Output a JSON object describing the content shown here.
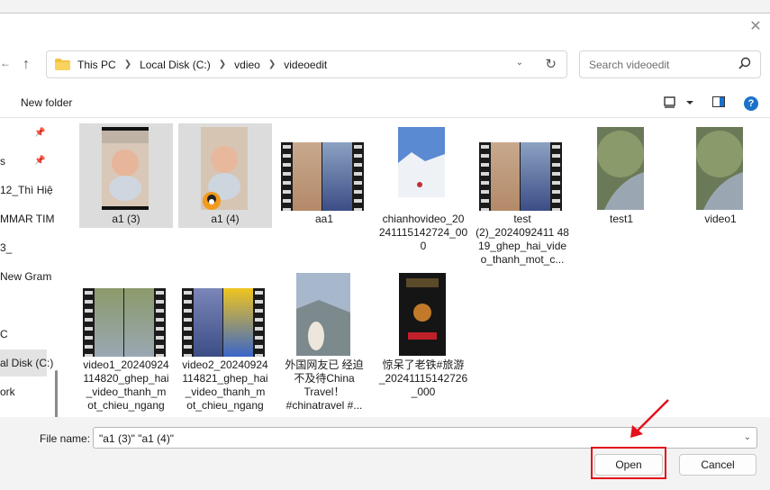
{
  "window": {
    "close_glyph": "✕"
  },
  "address": {
    "crumbs": [
      "This PC",
      "Local Disk (C:)",
      "vdieo",
      "videoedit"
    ],
    "search_placeholder": "Search videoedit"
  },
  "toolbar": {
    "new_folder": "New folder",
    "help_glyph": "?"
  },
  "sidebar": {
    "items": [
      {
        "label": "",
        "pinned": true
      },
      {
        "label": "s",
        "pinned": true
      },
      {
        "label": "12_Thì Hiệ"
      },
      {
        "label": "MMAR TIM"
      },
      {
        "label": "3_"
      },
      {
        "label": "New Gram"
      },
      {
        "label": "C"
      },
      {
        "label": "al Disk (C:)"
      },
      {
        "label": "ork"
      }
    ]
  },
  "files": [
    {
      "name": "a1 (3)",
      "kind": "portrait-photo",
      "selected": true
    },
    {
      "name": "a1 (4)",
      "kind": "portrait-photo",
      "selected": true
    },
    {
      "name": "aa1",
      "kind": "video"
    },
    {
      "name": "chianhovideo_20241115142724_000",
      "kind": "portrait-photo"
    },
    {
      "name": "test (2)_2024092411481 9_ghep_hai_video_thanh_mot_c...",
      "kind": "video"
    },
    {
      "name": "test1",
      "kind": "portrait-photo"
    },
    {
      "name": "video1",
      "kind": "portrait-photo"
    },
    {
      "name": "video1_20240924114820_ghep_hai_video_thanh_mot_chieu_ngang",
      "kind": "video"
    },
    {
      "name": "video2_20240924114821_ghep_hai_video_thanh_mot_chieu_ngang",
      "kind": "video"
    },
    {
      "name": "外国网友已经迫不及待China Travel！#chinatravel #...",
      "kind": "portrait-photo"
    },
    {
      "name": "惊呆了老铁#旅游_20241115142726_000",
      "kind": "portrait-photo"
    }
  ],
  "labels_display": [
    "a1 (3)",
    "a1 (4)",
    "aa1",
    "chianhovideo_20\n241115142724_00\n0",
    "test\n(2)_2024092411 48\n19_ghep_hai_vide\no_thanh_mot_c...",
    "test1",
    "video1",
    "video1_20240924\n114820_ghep_hai\n_video_thanh_m\not_chieu_ngang",
    "video2_20240924\n114821_ghep_hai\n_video_thanh_m\not_chieu_ngang",
    "外国网友已 经迫\n不及待China\nTravel！\n#chinatravel #...",
    "惊呆了老铁#旅游\n_20241115142726\n_000"
  ],
  "footer": {
    "file_name_label": "File name:",
    "file_name_value": "\"a1 (3)\" \"a1 (4)\"",
    "open_label": "Open",
    "cancel_label": "Cancel"
  },
  "colors": {
    "highlight": "#e5101a",
    "accent": "#1a73c9",
    "selection": "#dcdcdc"
  },
  "icons": [
    "folder-icon",
    "up-arrow-icon",
    "chevron-down-icon",
    "refresh-icon",
    "search-icon",
    "view-options-icon",
    "preview-pane-icon",
    "help-icon",
    "pin-icon",
    "close-icon"
  ]
}
